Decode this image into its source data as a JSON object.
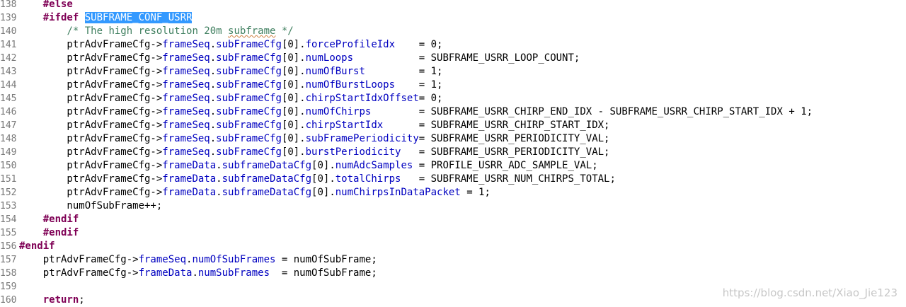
{
  "editor": {
    "lines": [
      {
        "no": "138",
        "tokens": [
          {
            "t": "    ",
            "k": "ws"
          },
          {
            "t": "#else",
            "k": "kw"
          }
        ]
      },
      {
        "no": "139",
        "tokens": [
          {
            "t": "    ",
            "k": "ws"
          },
          {
            "t": "#ifdef",
            "k": "kw"
          },
          {
            "t": " ",
            "k": "ws"
          },
          {
            "t": "SUBFRAME_CONF_USRR",
            "k": "sel"
          }
        ]
      },
      {
        "no": "140",
        "tokens": [
          {
            "t": "        ",
            "k": "ws"
          },
          {
            "t": "/* The high resolution 20m ",
            "k": "cm"
          },
          {
            "t": "subframe",
            "k": "cm-ul"
          },
          {
            "t": " */",
            "k": "cm"
          }
        ]
      },
      {
        "no": "141",
        "tokens": [
          {
            "t": "        ptrAdvFrameCfg->",
            "k": "id"
          },
          {
            "t": "frameSeq",
            "k": "field"
          },
          {
            "t": ".",
            "k": "op"
          },
          {
            "t": "subFrameCfg",
            "k": "field"
          },
          {
            "t": "[0].",
            "k": "op"
          },
          {
            "t": "forceProfileIdx",
            "k": "field"
          },
          {
            "t": "    = 0;",
            "k": "op"
          }
        ]
      },
      {
        "no": "142",
        "tokens": [
          {
            "t": "        ptrAdvFrameCfg->",
            "k": "id"
          },
          {
            "t": "frameSeq",
            "k": "field"
          },
          {
            "t": ".",
            "k": "op"
          },
          {
            "t": "subFrameCfg",
            "k": "field"
          },
          {
            "t": "[0].",
            "k": "op"
          },
          {
            "t": "numLoops",
            "k": "field"
          },
          {
            "t": "           = SUBFRAME_USRR_LOOP_COUNT;",
            "k": "op"
          }
        ]
      },
      {
        "no": "143",
        "tokens": [
          {
            "t": "        ptrAdvFrameCfg->",
            "k": "id"
          },
          {
            "t": "frameSeq",
            "k": "field"
          },
          {
            "t": ".",
            "k": "op"
          },
          {
            "t": "subFrameCfg",
            "k": "field"
          },
          {
            "t": "[0].",
            "k": "op"
          },
          {
            "t": "numOfBurst",
            "k": "field"
          },
          {
            "t": "         = 1;",
            "k": "op"
          }
        ]
      },
      {
        "no": "144",
        "tokens": [
          {
            "t": "        ptrAdvFrameCfg->",
            "k": "id"
          },
          {
            "t": "frameSeq",
            "k": "field"
          },
          {
            "t": ".",
            "k": "op"
          },
          {
            "t": "subFrameCfg",
            "k": "field"
          },
          {
            "t": "[0].",
            "k": "op"
          },
          {
            "t": "numOfBurstLoops",
            "k": "field"
          },
          {
            "t": "    = 1;",
            "k": "op"
          }
        ]
      },
      {
        "no": "145",
        "tokens": [
          {
            "t": "        ptrAdvFrameCfg->",
            "k": "id"
          },
          {
            "t": "frameSeq",
            "k": "field"
          },
          {
            "t": ".",
            "k": "op"
          },
          {
            "t": "subFrameCfg",
            "k": "field"
          },
          {
            "t": "[0].",
            "k": "op"
          },
          {
            "t": "chirpStartIdxOffset",
            "k": "field"
          },
          {
            "t": "= 0;",
            "k": "op"
          }
        ]
      },
      {
        "no": "146",
        "tokens": [
          {
            "t": "        ptrAdvFrameCfg->",
            "k": "id"
          },
          {
            "t": "frameSeq",
            "k": "field"
          },
          {
            "t": ".",
            "k": "op"
          },
          {
            "t": "subFrameCfg",
            "k": "field"
          },
          {
            "t": "[0].",
            "k": "op"
          },
          {
            "t": "numOfChirps",
            "k": "field"
          },
          {
            "t": "        = SUBFRAME_USRR_CHIRP_END_IDX - SUBFRAME_USRR_CHIRP_START_IDX + 1;",
            "k": "op"
          }
        ]
      },
      {
        "no": "147",
        "tokens": [
          {
            "t": "        ptrAdvFrameCfg->",
            "k": "id"
          },
          {
            "t": "frameSeq",
            "k": "field"
          },
          {
            "t": ".",
            "k": "op"
          },
          {
            "t": "subFrameCfg",
            "k": "field"
          },
          {
            "t": "[0].",
            "k": "op"
          },
          {
            "t": "chirpStartIdx",
            "k": "field"
          },
          {
            "t": "      = SUBFRAME_USRR_CHIRP_START_IDX;",
            "k": "op"
          }
        ]
      },
      {
        "no": "148",
        "tokens": [
          {
            "t": "        ptrAdvFrameCfg->",
            "k": "id"
          },
          {
            "t": "frameSeq",
            "k": "field"
          },
          {
            "t": ".",
            "k": "op"
          },
          {
            "t": "subFrameCfg",
            "k": "field"
          },
          {
            "t": "[0].",
            "k": "op"
          },
          {
            "t": "subFramePeriodicity",
            "k": "field"
          },
          {
            "t": "= SUBFRAME_USRR_PERIODICITY_VAL;",
            "k": "op"
          }
        ]
      },
      {
        "no": "149",
        "tokens": [
          {
            "t": "        ptrAdvFrameCfg->",
            "k": "id"
          },
          {
            "t": "frameSeq",
            "k": "field"
          },
          {
            "t": ".",
            "k": "op"
          },
          {
            "t": "subFrameCfg",
            "k": "field"
          },
          {
            "t": "[0].",
            "k": "op"
          },
          {
            "t": "burstPeriodicity",
            "k": "field"
          },
          {
            "t": "   = SUBFRAME_USRR_PERIODICITY_VAL;",
            "k": "op"
          }
        ]
      },
      {
        "no": "150",
        "tokens": [
          {
            "t": "        ptrAdvFrameCfg->",
            "k": "id"
          },
          {
            "t": "frameData",
            "k": "field"
          },
          {
            "t": ".",
            "k": "op"
          },
          {
            "t": "subframeDataCfg",
            "k": "field"
          },
          {
            "t": "[0].",
            "k": "op"
          },
          {
            "t": "numAdcSamples",
            "k": "field"
          },
          {
            "t": " = PROFILE_USRR_ADC_SAMPLE_VAL;",
            "k": "op"
          }
        ]
      },
      {
        "no": "151",
        "tokens": [
          {
            "t": "        ptrAdvFrameCfg->",
            "k": "id"
          },
          {
            "t": "frameData",
            "k": "field"
          },
          {
            "t": ".",
            "k": "op"
          },
          {
            "t": "subframeDataCfg",
            "k": "field"
          },
          {
            "t": "[0].",
            "k": "op"
          },
          {
            "t": "totalChirps",
            "k": "field"
          },
          {
            "t": "   = SUBFRAME_USRR_NUM_CHIRPS_TOTAL;",
            "k": "op"
          }
        ]
      },
      {
        "no": "152",
        "tokens": [
          {
            "t": "        ptrAdvFrameCfg->",
            "k": "id"
          },
          {
            "t": "frameData",
            "k": "field"
          },
          {
            "t": ".",
            "k": "op"
          },
          {
            "t": "subframeDataCfg",
            "k": "field"
          },
          {
            "t": "[0].",
            "k": "op"
          },
          {
            "t": "numChirpsInDataPacket",
            "k": "field"
          },
          {
            "t": " = 1;",
            "k": "op"
          }
        ]
      },
      {
        "no": "153",
        "tokens": [
          {
            "t": "        numOfSubFrame++;",
            "k": "id"
          }
        ]
      },
      {
        "no": "154",
        "tokens": [
          {
            "t": "    ",
            "k": "ws"
          },
          {
            "t": "#endif",
            "k": "kw"
          }
        ]
      },
      {
        "no": "155",
        "tokens": [
          {
            "t": "    ",
            "k": "ws"
          },
          {
            "t": "#endif",
            "k": "kw"
          }
        ]
      },
      {
        "no": "156",
        "tokens": [
          {
            "t": "#endif",
            "k": "kw"
          }
        ]
      },
      {
        "no": "157",
        "tokens": [
          {
            "t": "    ptrAdvFrameCfg->",
            "k": "id"
          },
          {
            "t": "frameSeq",
            "k": "field"
          },
          {
            "t": ".",
            "k": "op"
          },
          {
            "t": "numOfSubFrames",
            "k": "field"
          },
          {
            "t": " = numOfSubFrame;",
            "k": "op"
          }
        ]
      },
      {
        "no": "158",
        "tokens": [
          {
            "t": "    ptrAdvFrameCfg->",
            "k": "id"
          },
          {
            "t": "frameData",
            "k": "field"
          },
          {
            "t": ".",
            "k": "op"
          },
          {
            "t": "numSubFrames",
            "k": "field"
          },
          {
            "t": "  = numOfSubFrame;",
            "k": "op"
          }
        ]
      },
      {
        "no": "159",
        "tokens": []
      },
      {
        "no": "160",
        "tokens": [
          {
            "t": "    ",
            "k": "ws"
          },
          {
            "t": "return",
            "k": "kw"
          },
          {
            "t": ";",
            "k": "op"
          }
        ]
      }
    ]
  },
  "watermark": "https://blog.csdn.net/Xiao_Jie123"
}
